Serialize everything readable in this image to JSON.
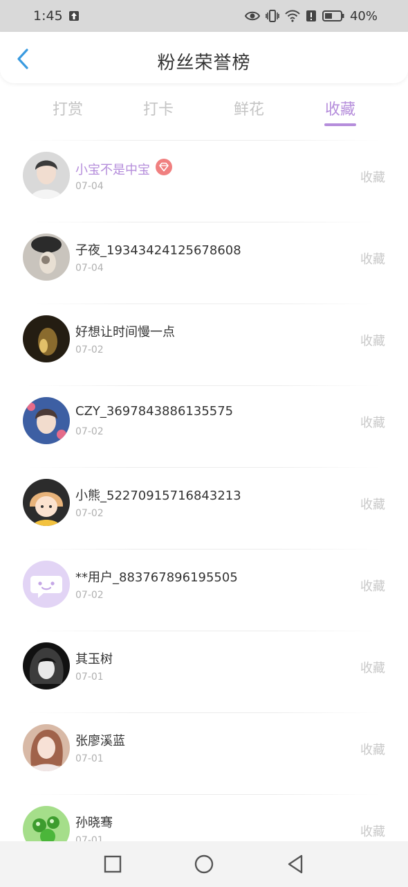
{
  "status_bar": {
    "time": "1:45",
    "battery": "40%"
  },
  "header": {
    "title": "粉丝荣誉榜",
    "back_icon": "chevron-left-icon"
  },
  "tabs": [
    {
      "label": "打赏",
      "active": false
    },
    {
      "label": "打卡",
      "active": false
    },
    {
      "label": "鲜花",
      "active": false
    },
    {
      "label": "收藏",
      "active": true
    }
  ],
  "colors": {
    "accent": "#b58ddb",
    "badge": "#f08080",
    "muted": "#c8c8c8"
  },
  "fans": [
    {
      "name": "小宝不是中宝",
      "date": "07-04",
      "action": "收藏",
      "vip": true,
      "badge_icon": "diamond-badge-icon"
    },
    {
      "name": "子夜_19343424125678608",
      "date": "07-04",
      "action": "收藏"
    },
    {
      "name": "好想让时间慢一点",
      "date": "07-02",
      "action": "收藏"
    },
    {
      "name": "CZY_3697843886135575",
      "date": "07-02",
      "action": "收藏"
    },
    {
      "name": "小熊_52270915716843213",
      "date": "07-02",
      "action": "收藏"
    },
    {
      "name": "**用户_883767896195505",
      "date": "07-02",
      "action": "收藏"
    },
    {
      "name": "其玉树",
      "date": "07-01",
      "action": "收藏"
    },
    {
      "name": "张廖溪蓝",
      "date": "07-01",
      "action": "收藏"
    },
    {
      "name": "孙晓骞",
      "date": "07-01",
      "action": "收藏"
    }
  ],
  "nav": {
    "recent_icon": "square-icon",
    "home_icon": "circle-icon",
    "back_icon": "triangle-back-icon"
  }
}
